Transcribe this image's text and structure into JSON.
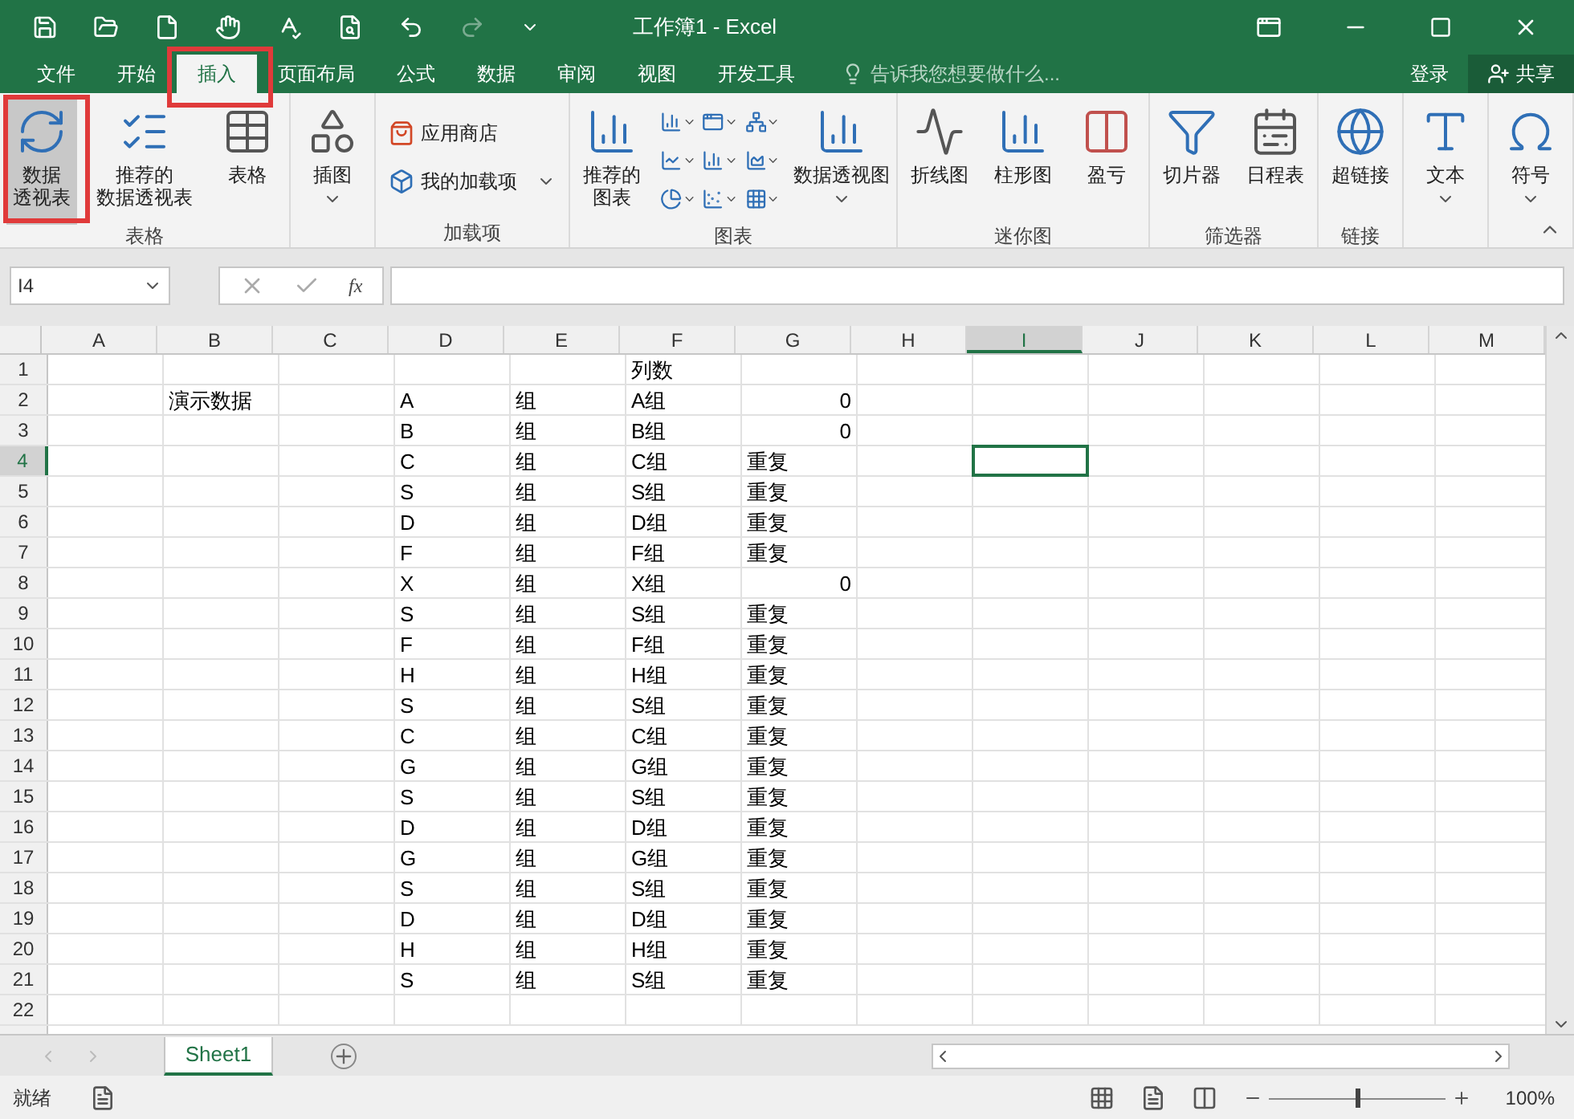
{
  "window": {
    "title": "工作簿1 - Excel"
  },
  "tabs": [
    {
      "label": "文件",
      "selected": false
    },
    {
      "label": "开始",
      "selected": false
    },
    {
      "label": "插入",
      "selected": true
    },
    {
      "label": "页面布局",
      "selected": false
    },
    {
      "label": "公式",
      "selected": false
    },
    {
      "label": "数据",
      "selected": false
    },
    {
      "label": "审阅",
      "selected": false
    },
    {
      "label": "视图",
      "selected": false
    },
    {
      "label": "开发工具",
      "selected": false
    }
  ],
  "tell_me": {
    "placeholder": "告诉我您想要做什么..."
  },
  "account": {
    "sign_in": "登录",
    "share": "共享"
  },
  "ribbon": [
    {
      "label": "表格",
      "items": [
        {
          "kind": "large",
          "lines": [
            "数据",
            "透视表"
          ],
          "selected": true
        },
        {
          "kind": "large",
          "lines": [
            "推荐的",
            "数据透视表"
          ],
          "selected": false
        },
        {
          "kind": "large",
          "lines": [
            "表格"
          ],
          "selected": false
        }
      ]
    },
    {
      "items": [
        {
          "kind": "large",
          "lines": [
            "插图"
          ],
          "selected": false,
          "dropdown": true
        }
      ]
    },
    {
      "label": "加载项",
      "items": [
        {
          "kind": "small",
          "label": "应用商店",
          "dropdown": false
        },
        {
          "kind": "small",
          "label": "我的加载项",
          "dropdown": true
        }
      ]
    },
    {
      "label": "图表",
      "items": [
        {
          "kind": "large",
          "lines": [
            "推荐的",
            "图表"
          ],
          "selected": false
        },
        {
          "kind": "chart-grid"
        },
        {
          "kind": "large",
          "lines": [
            "数据透视图"
          ],
          "selected": false,
          "dropdown": true
        }
      ]
    },
    {
      "label": "迷你图",
      "items": [
        {
          "kind": "large",
          "lines": [
            "折线图"
          ],
          "selected": false
        },
        {
          "kind": "large",
          "lines": [
            "柱形图"
          ],
          "selected": false
        },
        {
          "kind": "large",
          "lines": [
            "盈亏"
          ],
          "selected": false
        }
      ]
    },
    {
      "label": "筛选器",
      "items": [
        {
          "kind": "large",
          "lines": [
            "切片器"
          ],
          "selected": false
        },
        {
          "kind": "large",
          "lines": [
            "日程表"
          ],
          "selected": false
        }
      ]
    },
    {
      "label": "链接",
      "items": [
        {
          "kind": "large",
          "lines": [
            "超链接"
          ],
          "selected": false
        }
      ]
    },
    {
      "items": [
        {
          "kind": "large",
          "lines": [
            "文本"
          ],
          "selected": false,
          "dropdown": true
        }
      ]
    },
    {
      "items": [
        {
          "kind": "large",
          "lines": [
            "符号"
          ],
          "selected": false,
          "dropdown": true
        }
      ]
    }
  ],
  "formula_bar": {
    "name_box": "I4",
    "function_label": "fx"
  },
  "columns": [
    {
      "label": "A",
      "selected": false
    },
    {
      "label": "B",
      "selected": false
    },
    {
      "label": "C",
      "selected": false
    },
    {
      "label": "D",
      "selected": false
    },
    {
      "label": "E",
      "selected": false
    },
    {
      "label": "F",
      "selected": false
    },
    {
      "label": "G",
      "selected": false
    },
    {
      "label": "H",
      "selected": false
    },
    {
      "label": "I",
      "selected": true
    },
    {
      "label": "J",
      "selected": false
    },
    {
      "label": "K",
      "selected": false
    },
    {
      "label": "L",
      "selected": false
    },
    {
      "label": "M",
      "selected": false
    }
  ],
  "rows": [
    {
      "number": "1",
      "selected": false,
      "cells": {
        "F": "列数"
      }
    },
    {
      "number": "2",
      "selected": false,
      "cells": {
        "B": "演示数据",
        "D": "A",
        "E": "组",
        "F": "A组",
        "G": "0"
      }
    },
    {
      "number": "3",
      "selected": false,
      "cells": {
        "D": "B",
        "E": "组",
        "F": "B组",
        "G": "0"
      }
    },
    {
      "number": "4",
      "selected": true,
      "cells": {
        "D": "C",
        "E": "组",
        "F": "C组",
        "G": "重复"
      }
    },
    {
      "number": "5",
      "selected": false,
      "cells": {
        "D": "S",
        "E": "组",
        "F": "S组",
        "G": "重复"
      }
    },
    {
      "number": "6",
      "selected": false,
      "cells": {
        "D": "D",
        "E": "组",
        "F": "D组",
        "G": "重复"
      }
    },
    {
      "number": "7",
      "selected": false,
      "cells": {
        "D": "F",
        "E": "组",
        "F": "F组",
        "G": "重复"
      }
    },
    {
      "number": "8",
      "selected": false,
      "cells": {
        "D": "X",
        "E": "组",
        "F": "X组",
        "G": "0"
      }
    },
    {
      "number": "9",
      "selected": false,
      "cells": {
        "D": "S",
        "E": "组",
        "F": "S组",
        "G": "重复"
      }
    },
    {
      "number": "10",
      "selected": false,
      "cells": {
        "D": "F",
        "E": "组",
        "F": "F组",
        "G": "重复"
      }
    },
    {
      "number": "11",
      "selected": false,
      "cells": {
        "D": "H",
        "E": "组",
        "F": "H组",
        "G": "重复"
      }
    },
    {
      "number": "12",
      "selected": false,
      "cells": {
        "D": "S",
        "E": "组",
        "F": "S组",
        "G": "重复"
      }
    },
    {
      "number": "13",
      "selected": false,
      "cells": {
        "D": "C",
        "E": "组",
        "F": "C组",
        "G": "重复"
      }
    },
    {
      "number": "14",
      "selected": false,
      "cells": {
        "D": "G",
        "E": "组",
        "F": "G组",
        "G": "重复"
      }
    },
    {
      "number": "15",
      "selected": false,
      "cells": {
        "D": "S",
        "E": "组",
        "F": "S组",
        "G": "重复"
      }
    },
    {
      "number": "16",
      "selected": false,
      "cells": {
        "D": "D",
        "E": "组",
        "F": "D组",
        "G": "重复"
      }
    },
    {
      "number": "17",
      "selected": false,
      "cells": {
        "D": "G",
        "E": "组",
        "F": "G组",
        "G": "重复"
      }
    },
    {
      "number": "18",
      "selected": false,
      "cells": {
        "D": "S",
        "E": "组",
        "F": "S组",
        "G": "重复"
      }
    },
    {
      "number": "19",
      "selected": false,
      "cells": {
        "D": "D",
        "E": "组",
        "F": "D组",
        "G": "重复"
      }
    },
    {
      "number": "20",
      "selected": false,
      "cells": {
        "D": "H",
        "E": "组",
        "F": "H组",
        "G": "重复"
      }
    },
    {
      "number": "21",
      "selected": false,
      "cells": {
        "D": "S",
        "E": "组",
        "F": "S组",
        "G": "重复"
      }
    },
    {
      "number": "22",
      "selected": false,
      "cells": {}
    }
  ],
  "sheets": [
    {
      "label": "Sheet1",
      "selected": true
    }
  ],
  "status_bar": {
    "text": "就绪",
    "zoom": "100%",
    "level": 0.5
  }
}
